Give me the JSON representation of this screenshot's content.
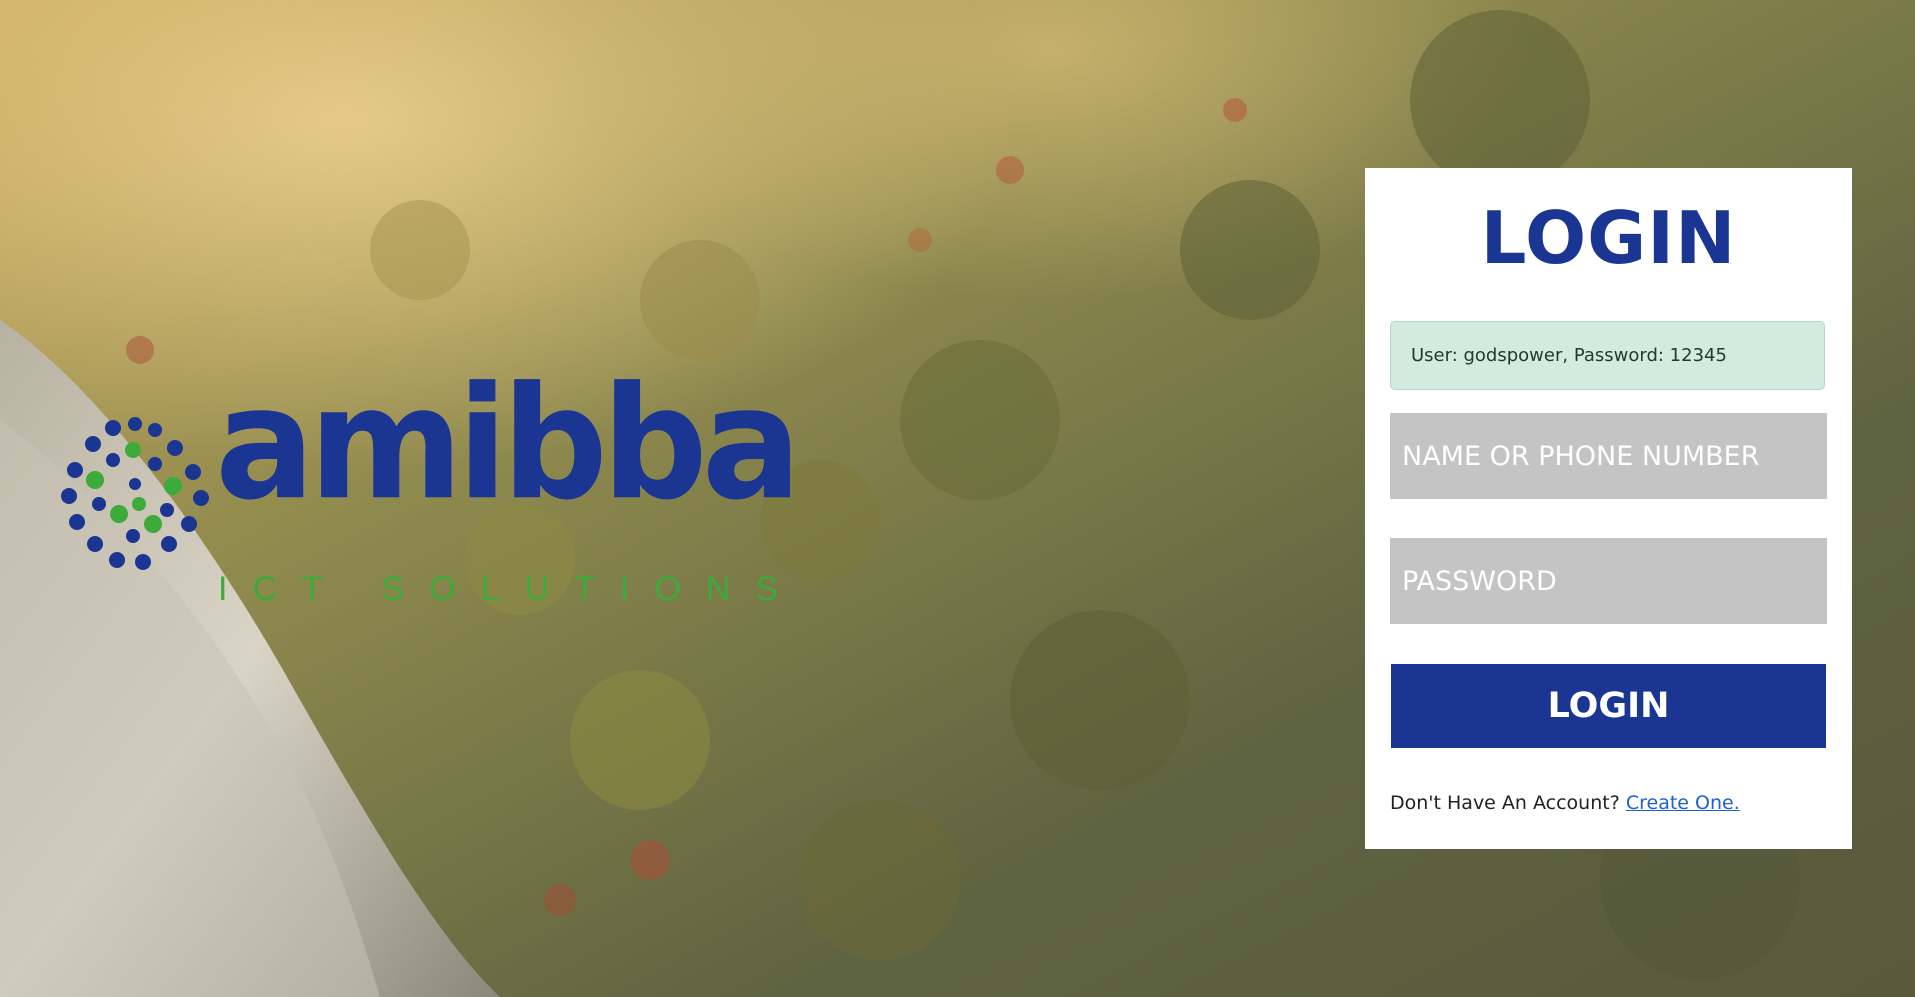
{
  "logo": {
    "name": "amibba",
    "tagline": "ICT SOLUTIONS"
  },
  "login_card": {
    "title": "LOGIN",
    "alert_text": "User: godspower, Password: 12345",
    "username_placeholder": "NAME OR PHONE NUMBER",
    "password_placeholder": "PASSWORD",
    "submit_label": "LOGIN",
    "signup_prompt": "Don't Have An Account?",
    "signup_link": "Create One."
  },
  "colors": {
    "brand_blue": "#1b3593",
    "brand_green": "#3dab3a",
    "alert_bg": "#d2eadf",
    "input_bg": "#c4c4c4",
    "link": "#1f5fd6"
  }
}
